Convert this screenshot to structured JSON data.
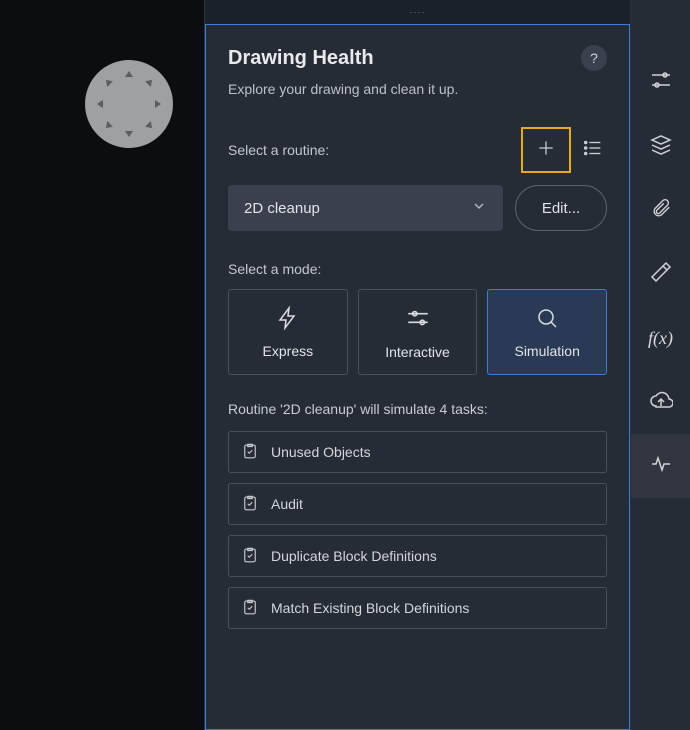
{
  "panel": {
    "title": "Drawing Health",
    "subtitle": "Explore your drawing and clean it up.",
    "select_routine_label": "Select a routine:",
    "select_mode_label": "Select a mode:",
    "routine_selected": "2D cleanup",
    "edit_label": "Edit...",
    "summary": "Routine '2D cleanup' will simulate 4 tasks:",
    "help_label": "?"
  },
  "modes": [
    {
      "key": "express",
      "label": "Express"
    },
    {
      "key": "interactive",
      "label": "Interactive"
    },
    {
      "key": "simulation",
      "label": "Simulation",
      "selected": true
    }
  ],
  "tasks": [
    {
      "label": "Unused Objects"
    },
    {
      "label": "Audit"
    },
    {
      "label": "Duplicate Block Definitions"
    },
    {
      "label": "Match Existing Block Definitions"
    }
  ],
  "rail": {
    "settings": "settings-icon",
    "layers": "layers-icon",
    "attach": "paperclip-icon",
    "measure": "measure-icon",
    "fx": "f(x)",
    "cloud": "cloud-upload-icon",
    "health": "drawing-health-icon"
  },
  "drag_handle": "····"
}
